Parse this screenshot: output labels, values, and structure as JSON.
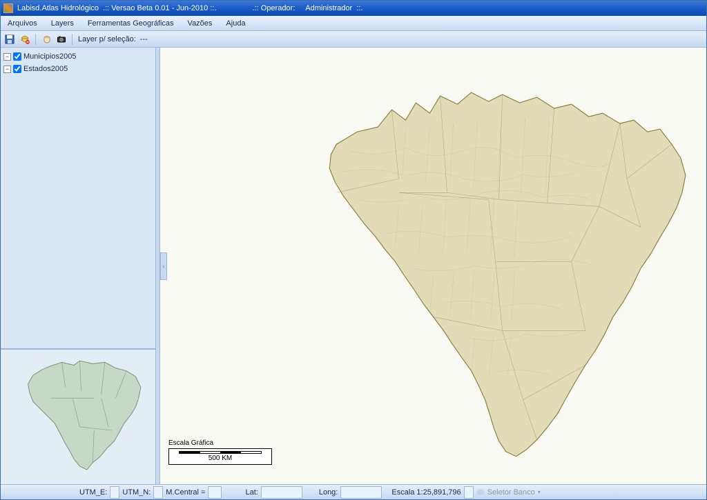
{
  "titlebar": {
    "app": "Labisd.Atlas Hidrológico",
    "version": ".:: Versao Beta 0.01 - Jun-2010 ::.",
    "operator_label": ".:: Operador:",
    "operator_value": "Administrador  ::."
  },
  "menu": {
    "arquivos": "Arquivos",
    "layers": "Layers",
    "ferramentas": "Ferramentas Geográficas",
    "vazoes": "Vazões",
    "ajuda": "Ajuda"
  },
  "toolbar": {
    "layer_sel_label": "Layer p/ seleção:",
    "layer_sel_value": "---"
  },
  "layers": {
    "items": [
      {
        "name": "Municipios2005",
        "checked": true,
        "expander": "−"
      },
      {
        "name": "Estados2005",
        "checked": true,
        "expander": "−"
      }
    ]
  },
  "scale": {
    "title": "Escala Gráfica",
    "text": "500 KM"
  },
  "status": {
    "utme": "UTM_E:",
    "utmn": "UTM_N:",
    "mcentral": "M.Central =",
    "lat": "Lat:",
    "long": "Long:",
    "escala_label": "Escala 1:",
    "escala_value": "25,891,796",
    "seletor": "Seletor Banco"
  },
  "icons": {
    "save": "save-icon",
    "delete": "delete-layer-icon",
    "hand": "pan-icon",
    "camera": "snapshot-icon"
  },
  "colors": {
    "map_fill": "#e1dbb8",
    "map_stroke": "#8a8243",
    "overview_fill": "#c7d9c6",
    "overview_stroke": "#7a987a"
  }
}
